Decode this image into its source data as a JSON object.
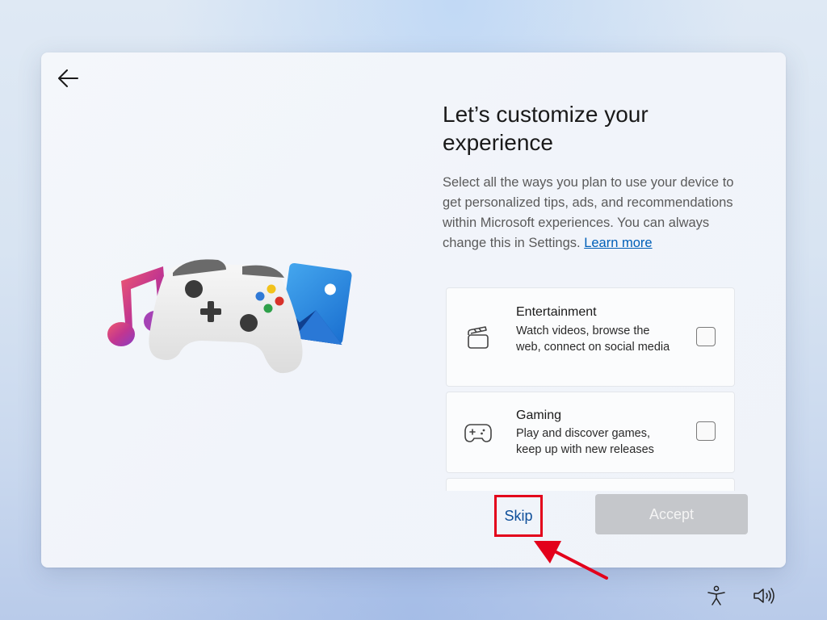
{
  "header": {
    "back_icon": "arrow-left-icon"
  },
  "main": {
    "title": "Let’s customize your experience",
    "description": "Select all the ways you plan to use your device to get personalized tips, ads, and recommendations within Microsoft experiences. You can always change this in Settings.",
    "learn_more": "Learn more"
  },
  "options": [
    {
      "icon": "clapperboard-icon",
      "title": "Entertainment",
      "description": "Watch videos, browse the web, connect on social media",
      "checked": false
    },
    {
      "icon": "gamepad-icon",
      "title": "Gaming",
      "description": "Play and discover games, keep up with new releases",
      "checked": false
    }
  ],
  "footer": {
    "skip_label": "Skip",
    "accept_label": "Accept",
    "accept_enabled": false
  },
  "annotation": {
    "highlight_color": "#e3001b",
    "target": "skip-button"
  },
  "system_tray": {
    "accessibility_icon": "accessibility-icon",
    "volume_icon": "volume-icon"
  },
  "colors": {
    "link": "#005fb8",
    "skip_text": "#0e4f9a",
    "accept_disabled_bg": "#c5c7cb"
  }
}
